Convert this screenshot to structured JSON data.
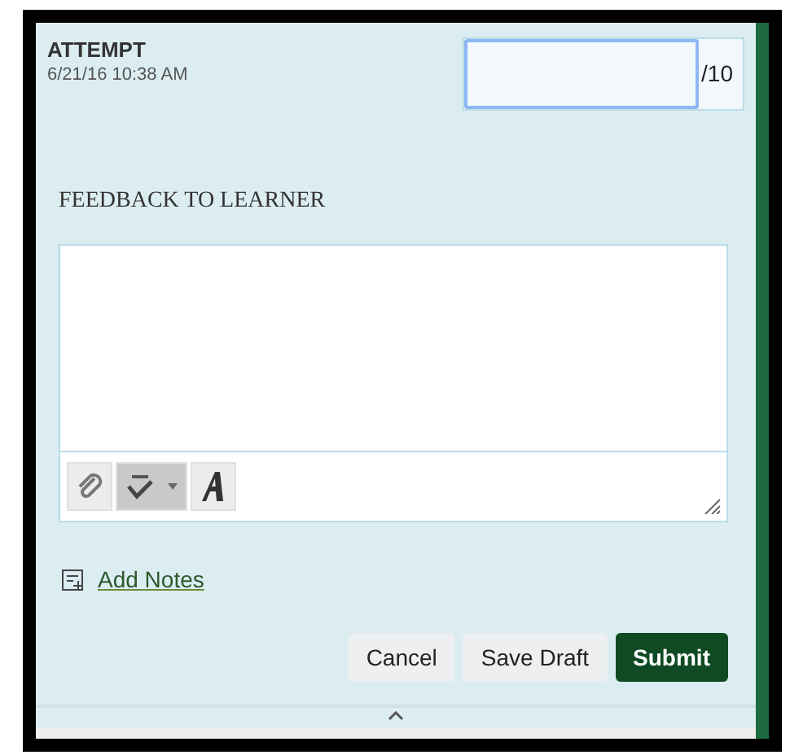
{
  "attempt": {
    "label": "ATTEMPT",
    "date": "6/21/16 10:38 AM"
  },
  "score": {
    "max": "/10",
    "focused": true
  },
  "feedback": {
    "label": "FEEDBACK TO LEARNER"
  },
  "toolbar": {
    "spellcheck_on": true
  },
  "add_notes": "Add Notes",
  "buttons": [
    {
      "label": "Cancel",
      "kind": "plain"
    },
    {
      "label": "Save Draft",
      "kind": "plain"
    },
    {
      "label": "Submit",
      "kind": "primary"
    }
  ]
}
